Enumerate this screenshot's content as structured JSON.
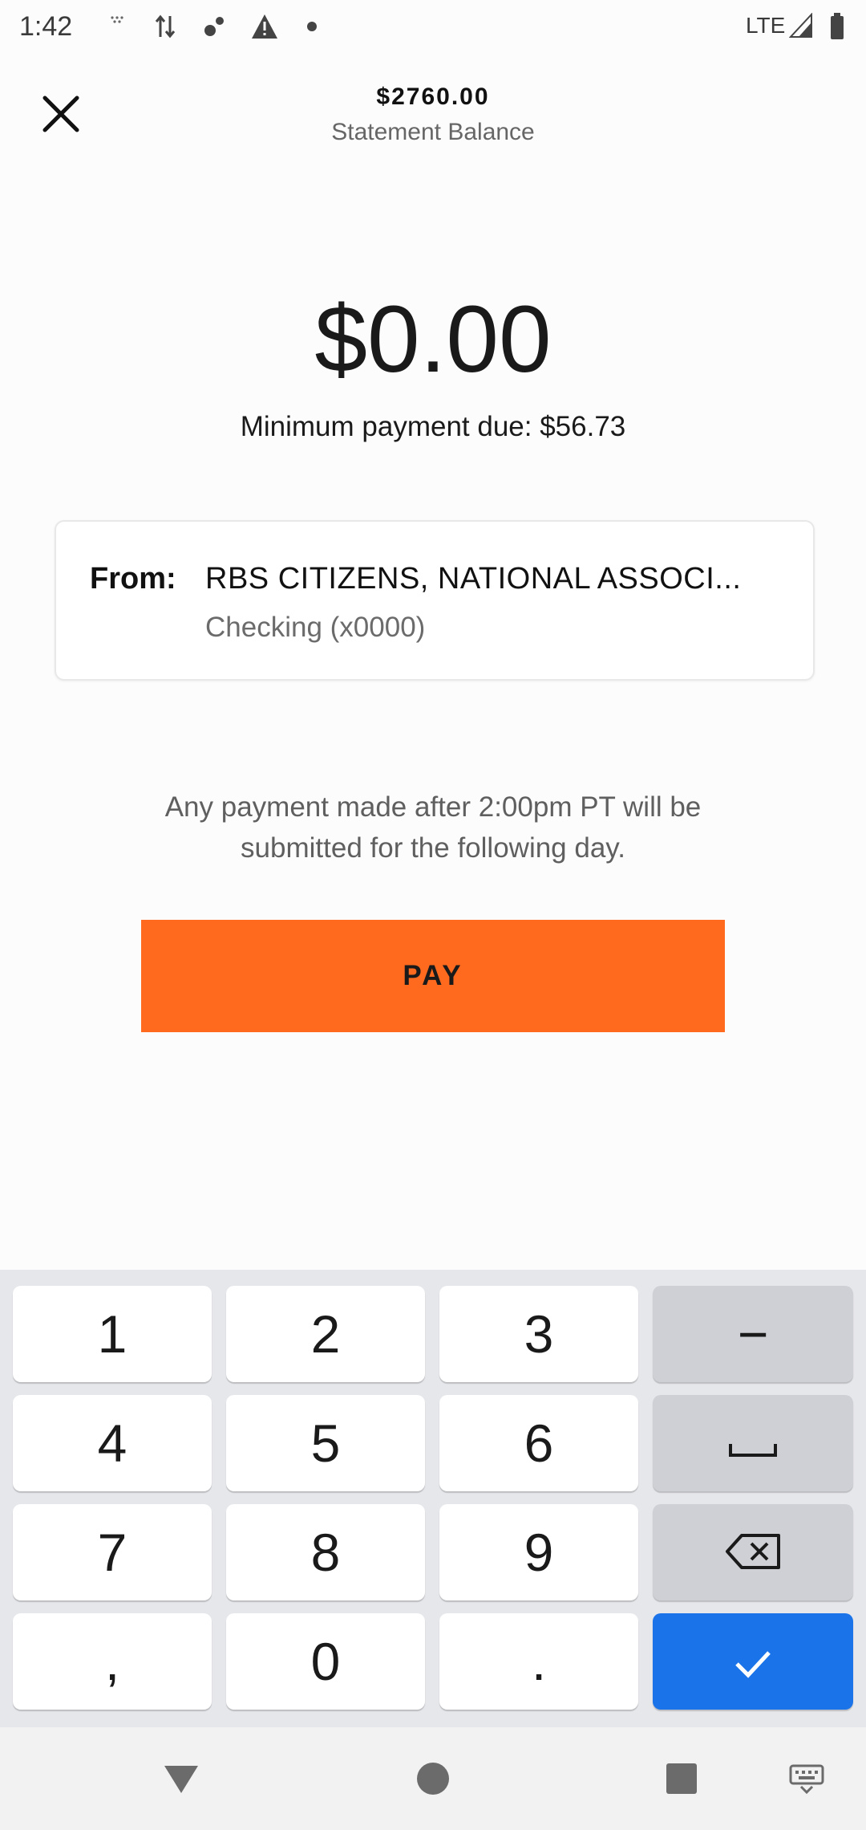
{
  "status_bar": {
    "time": "1:42",
    "network": "LTE",
    "icons": [
      "dots-icon",
      "data-transfer-icon",
      "gear-network-icon",
      "warning-icon",
      "notification-dot-icon",
      "signal-icon",
      "battery-icon"
    ]
  },
  "header": {
    "close_icon": "close-icon",
    "balance_amount": "$2760.00",
    "balance_label": "Statement Balance"
  },
  "payment": {
    "amount": "$0.00",
    "minimum_due": "Minimum payment due: $56.73"
  },
  "from_account": {
    "label": "From:",
    "bank_name": "RBS CITIZENS, NATIONAL ASSOCI...",
    "account": "Checking (x0000)"
  },
  "notice": {
    "line1": "Any payment made after 2:00pm PT will be",
    "line2": "submitted for the following day."
  },
  "pay_button": {
    "label": "PAY",
    "color": "#ff6a1f"
  },
  "keyboard": {
    "rows": [
      [
        "1",
        "2",
        "3",
        "−"
      ],
      [
        "4",
        "5",
        "6",
        "space"
      ],
      [
        "7",
        "8",
        "9",
        "backspace"
      ],
      [
        ",",
        "0",
        ".",
        "enter"
      ]
    ],
    "enter_color": "#1a73e8"
  },
  "nav_bar": {
    "items": [
      "back-icon",
      "home-icon",
      "recents-icon",
      "keyboard-switch-icon"
    ]
  }
}
